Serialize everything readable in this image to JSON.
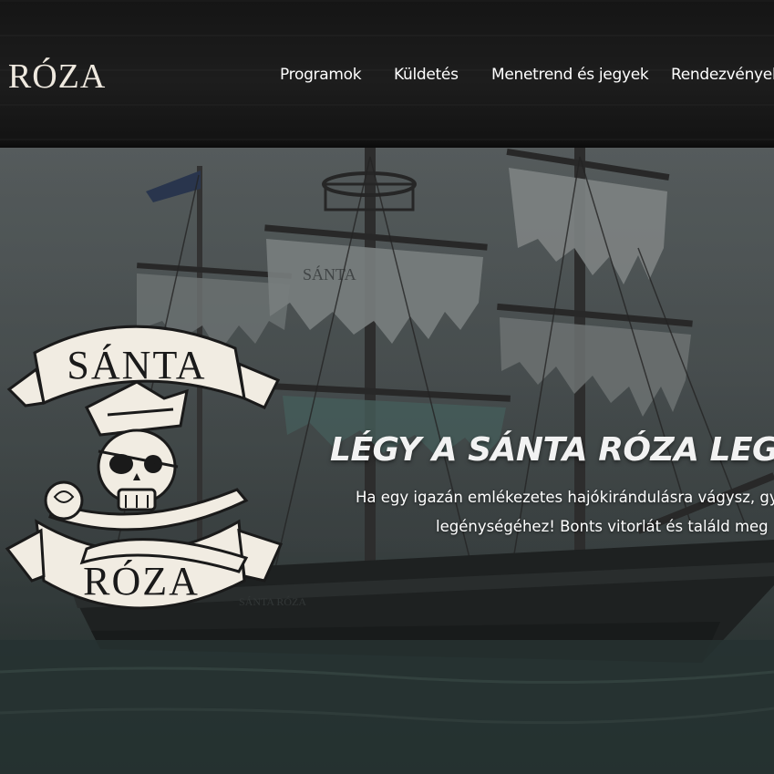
{
  "header": {
    "brand": "A RÓZA",
    "nav": [
      {
        "label": "Programok"
      },
      {
        "label": "Küldetés"
      },
      {
        "label": "Menetrend és jegyek"
      },
      {
        "label": "Rendezvények"
      }
    ]
  },
  "hero": {
    "title": "LÉGY A SÁNTA RÓZA LEGÉNYS",
    "text_line1": "Ha egy igazán emlékezetes hajókirándulásra vágysz, gy",
    "text_line2": "legénységéhez! Bonts vitorlát és találd meg",
    "logo": {
      "top": "SÁNTA",
      "bottom": "RÓZA"
    },
    "sail_text": "SÁNTA",
    "hull_text": "SÁNTA RÓZA"
  }
}
